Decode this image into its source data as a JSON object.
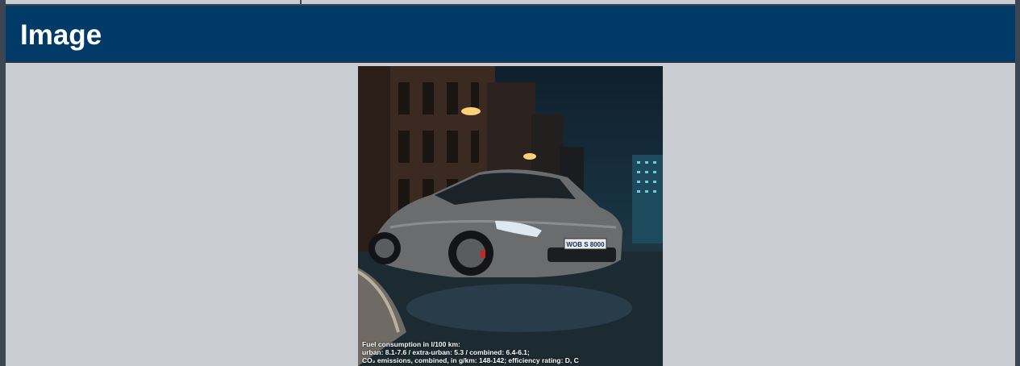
{
  "section": {
    "title": "Image"
  },
  "photo": {
    "plate": "WOB S 8000",
    "caption": {
      "line1": "Fuel consumption in l/100 km:",
      "line2": "urban: 8.1-7.6 / extra-urban: 5.3 / combined: 6.4-6.1;",
      "line3": "CO₂ emissions, combined, in g/km: 148-142; efficiency rating: D, C"
    }
  },
  "colors": {
    "header_bg": "#003a66",
    "page_bg": "#c9cdd2",
    "border": "#3a4652"
  }
}
